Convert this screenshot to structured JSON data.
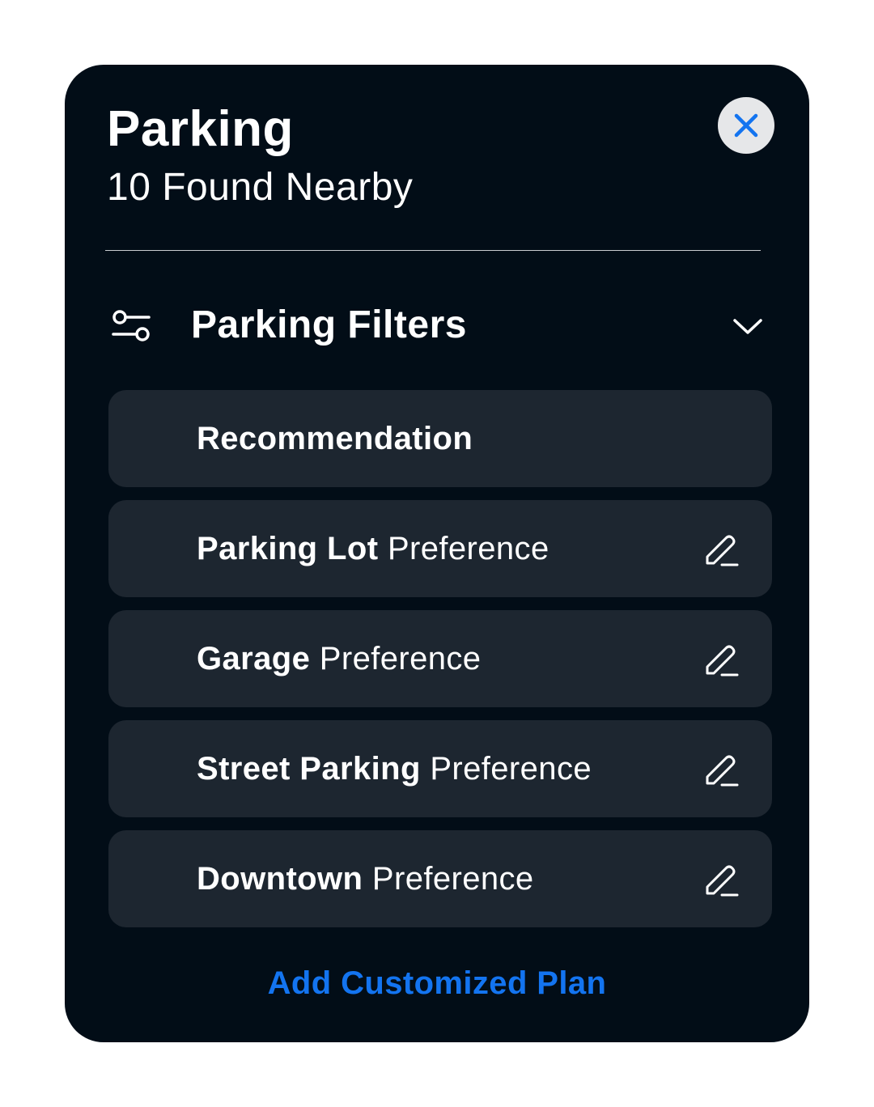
{
  "header": {
    "title": "Parking",
    "subtitle": "10 Found Nearby"
  },
  "close": {
    "icon": "close-icon",
    "color": "#1374f0"
  },
  "filters": {
    "label": "Parking Filters",
    "icon": "sliders-icon",
    "chevron": "chevron-down-icon"
  },
  "options": [
    {
      "bold": "Recommendation",
      "regular": "",
      "editable": false
    },
    {
      "bold": "Parking Lot",
      "regular": "Preference",
      "editable": true
    },
    {
      "bold": "Garage",
      "regular": "Preference",
      "editable": true
    },
    {
      "bold": "Street Parking",
      "regular": "Preference",
      "editable": true
    },
    {
      "bold": "Downtown",
      "regular": "Preference",
      "editable": true
    }
  ],
  "add_plan": {
    "label": "Add Customized Plan"
  },
  "colors": {
    "background": "#ffffff",
    "card": "#020d17",
    "row": "#1d2630",
    "accent": "#1374f0",
    "close_bg": "#e6e7e9"
  }
}
